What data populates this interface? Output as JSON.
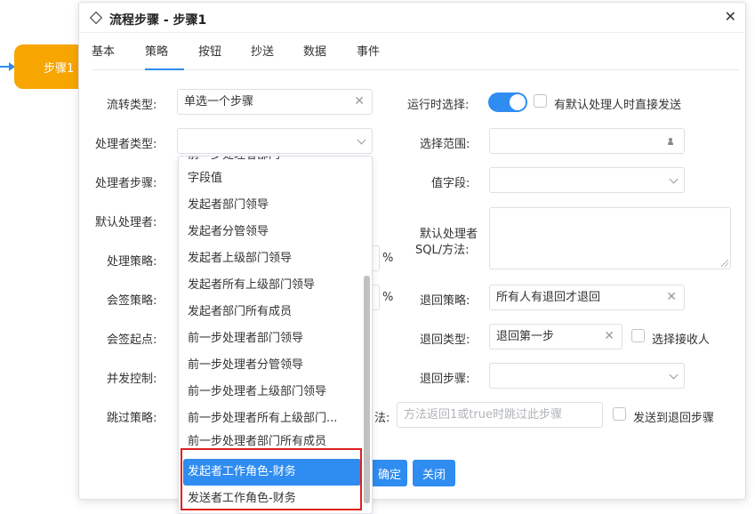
{
  "canvas": {
    "step_node_label": "步骤1",
    "accent_color": "#2f8cf0",
    "node_color": "#f7a500"
  },
  "dialog": {
    "icon": "diamond-icon",
    "title": "流程步骤 - 步骤1",
    "close_icon": "close-icon",
    "tabs": [
      "基本",
      "策略",
      "按钮",
      "抄送",
      "数据",
      "事件"
    ],
    "active_tab": "策略"
  },
  "form": {
    "flow_type_label": "流转类型:",
    "flow_type_value": "单选一个步骤",
    "handler_type_label": "处理者类型:",
    "handler_type_value": "",
    "handler_step_label": "处理者步骤:",
    "default_handler_label": "默认处理者:",
    "handle_strategy_label": "处理策略:",
    "countersign_strategy_label": "会签策略:",
    "countersign_start_label": "会签起点:",
    "concurrency_label": "并发控制:",
    "skip_strategy_label": "跳过策略:",
    "percent_sign": "%",
    "runtime_select_label": "运行时选择:",
    "runtime_select_on": true,
    "auto_send_label": "有默认处理人时直接发送",
    "select_scope_label": "选择范围:",
    "value_field_label": "值字段:",
    "default_sql_label_line1": "默认处理者",
    "default_sql_label_line2": "SQL/方法:",
    "return_strategy_label": "退回策略:",
    "return_strategy_value": "所有人有退回才退回",
    "return_type_label": "退回类型:",
    "return_type_value": "退回第一步",
    "select_receiver_label": "选择接收人",
    "return_step_label": "退回步骤:",
    "skip_method_label_tail": "法:",
    "skip_method_placeholder": "方法返回1或true时跳过此步骤",
    "send_to_return_step_label": "发送到退回步骤"
  },
  "buttons": {
    "confirm": "确定",
    "close": "关闭"
  },
  "dropdown": {
    "clipped_top_item": "前一步处理者部门",
    "items": [
      "字段值",
      "发起者部门领导",
      "发起者分管领导",
      "发起者上级部门领导",
      "发起者所有上级部门领导",
      "发起者部门所有成员",
      "前一步处理者部门领导",
      "前一步处理者分管领导",
      "前一步处理者上级部门领导",
      "前一步处理者所有上级部门...",
      "前一步处理者部门所有成员",
      "发起者工作角色-财务",
      "发送者工作角色-财务"
    ],
    "selected_item": "发起者工作角色-财务",
    "highlight_color": "#e02020"
  }
}
